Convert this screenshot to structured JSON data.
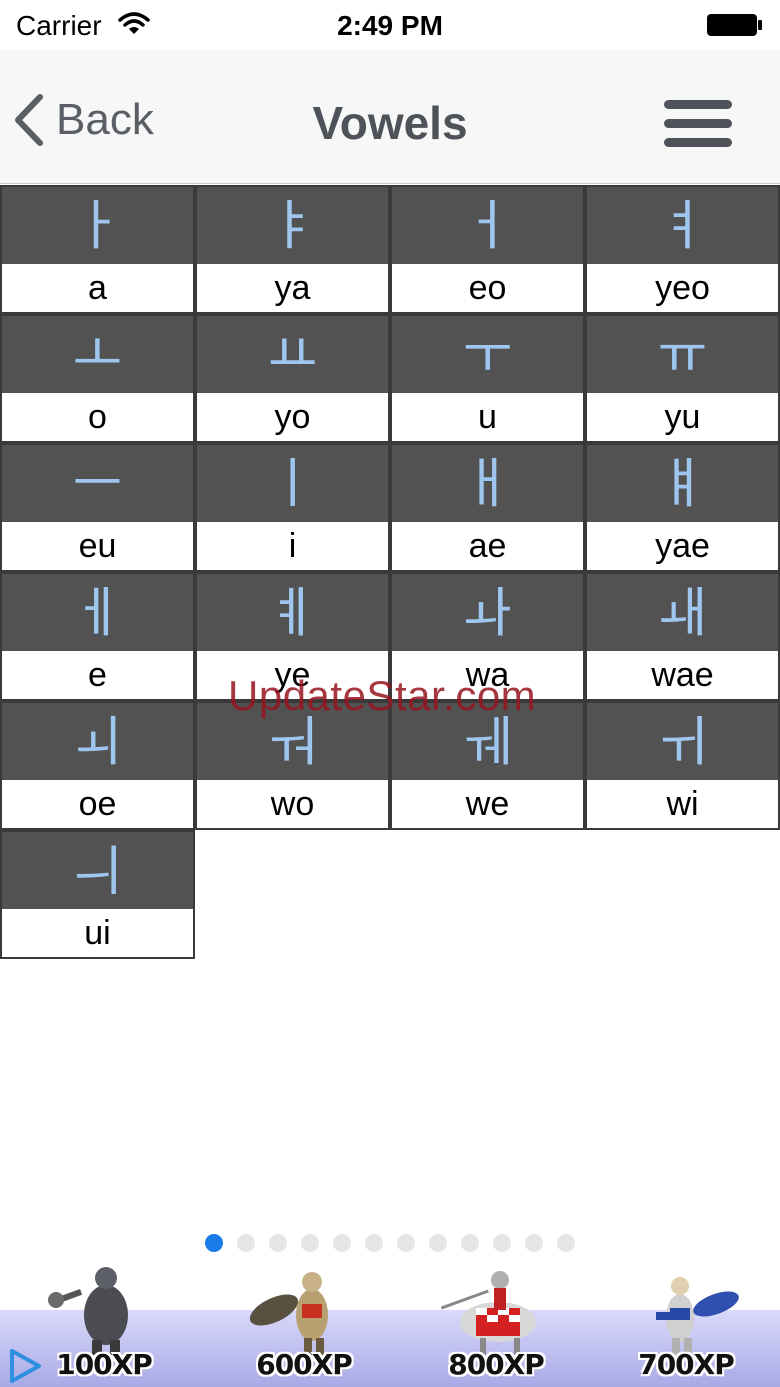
{
  "status_bar": {
    "carrier": "Carrier",
    "time": "2:49 PM"
  },
  "nav": {
    "back_label": "Back",
    "title": "Vowels"
  },
  "vowels": [
    {
      "hangul": "ㅏ",
      "roman": "a"
    },
    {
      "hangul": "ㅑ",
      "roman": "ya"
    },
    {
      "hangul": "ㅓ",
      "roman": "eo"
    },
    {
      "hangul": "ㅕ",
      "roman": "yeo"
    },
    {
      "hangul": "ㅗ",
      "roman": "o"
    },
    {
      "hangul": "ㅛ",
      "roman": "yo"
    },
    {
      "hangul": "ㅜ",
      "roman": "u"
    },
    {
      "hangul": "ㅠ",
      "roman": "yu"
    },
    {
      "hangul": "ㅡ",
      "roman": "eu"
    },
    {
      "hangul": "ㅣ",
      "roman": "i"
    },
    {
      "hangul": "ㅐ",
      "roman": "ae"
    },
    {
      "hangul": "ㅒ",
      "roman": "yae"
    },
    {
      "hangul": "ㅔ",
      "roman": "e"
    },
    {
      "hangul": "ㅖ",
      "roman": "ye"
    },
    {
      "hangul": "ㅘ",
      "roman": "wa"
    },
    {
      "hangul": "ㅙ",
      "roman": "wae"
    },
    {
      "hangul": "ㅚ",
      "roman": "oe"
    },
    {
      "hangul": "ㅝ",
      "roman": "wo"
    },
    {
      "hangul": "ㅞ",
      "roman": "we"
    },
    {
      "hangul": "ㅟ",
      "roman": "wi"
    },
    {
      "hangul": "ㅢ",
      "roman": "ui"
    }
  ],
  "watermark": "UpdateStar.com",
  "pager": {
    "count": 12,
    "active_index": 0
  },
  "ad": {
    "xp_labels": [
      "100XP",
      "600XP",
      "800XP",
      "700XP"
    ]
  },
  "colors": {
    "glyph_band": "#525252",
    "glyph_text": "#9fc6ef",
    "active_dot": "#1a7ce8",
    "nav_text": "#4e5359"
  }
}
